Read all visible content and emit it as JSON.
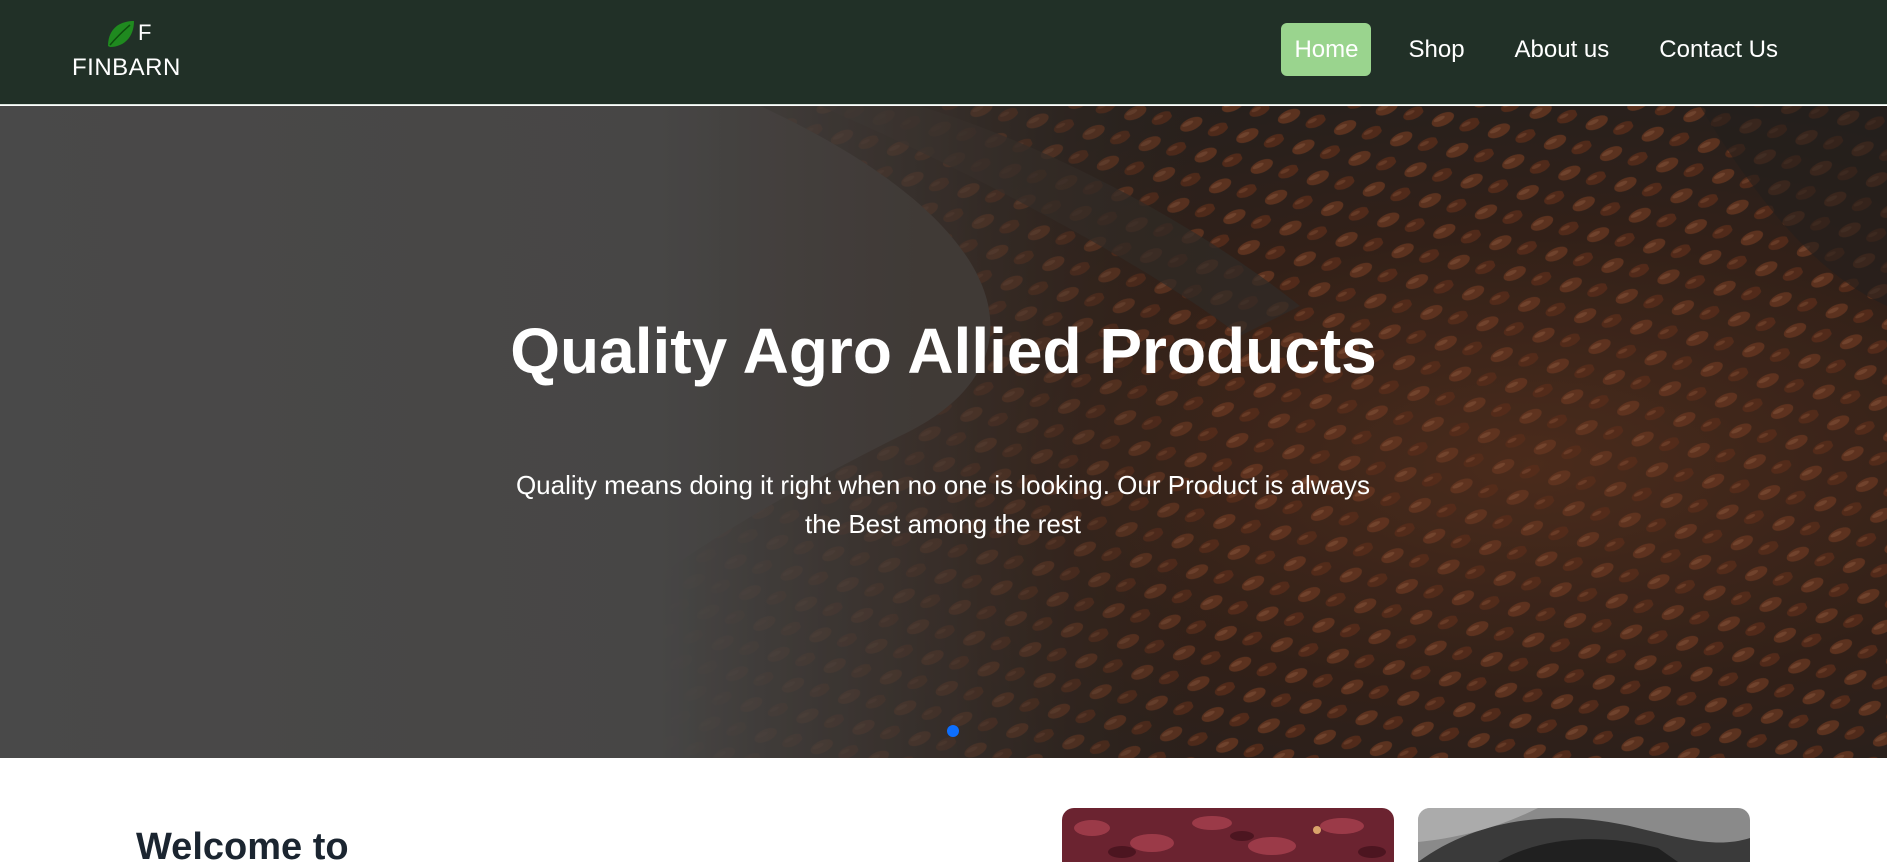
{
  "brand": {
    "letter": "F",
    "name": "FINBARN",
    "icon": "leaf-icon",
    "icon_color": "#1f8a1f"
  },
  "nav": {
    "items": [
      {
        "label": "Home",
        "active": true
      },
      {
        "label": "Shop",
        "active": false
      },
      {
        "label": "About us",
        "active": false
      },
      {
        "label": "Contact Us",
        "active": false
      }
    ],
    "active_color": "#9ad48e",
    "bar_color": "#213027"
  },
  "hero": {
    "title": "Quality Agro Allied Products",
    "subtitle": "Quality means doing it right when no one is looking. Our Product is always the Best among the rest",
    "image": "flax-seeds-photo",
    "indicator_color": "#0d6efd"
  },
  "section": {
    "heading": "Welcome to"
  },
  "cards": [
    {
      "image": "hibiscus-flowers-photo"
    },
    {
      "image": "dark-grain-sack-photo"
    }
  ]
}
